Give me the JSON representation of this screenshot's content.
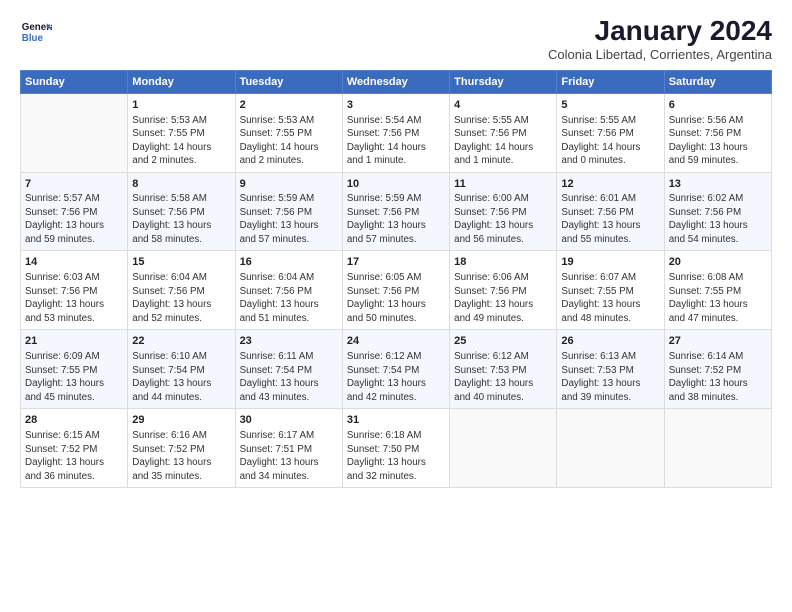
{
  "header": {
    "logo_line1": "General",
    "logo_line2": "Blue",
    "title": "January 2024",
    "subtitle": "Colonia Libertad, Corrientes, Argentina"
  },
  "weekdays": [
    "Sunday",
    "Monday",
    "Tuesday",
    "Wednesday",
    "Thursday",
    "Friday",
    "Saturday"
  ],
  "weeks": [
    [
      {
        "num": "",
        "info": ""
      },
      {
        "num": "1",
        "info": "Sunrise: 5:53 AM\nSunset: 7:55 PM\nDaylight: 14 hours\nand 2 minutes."
      },
      {
        "num": "2",
        "info": "Sunrise: 5:53 AM\nSunset: 7:55 PM\nDaylight: 14 hours\nand 2 minutes."
      },
      {
        "num": "3",
        "info": "Sunrise: 5:54 AM\nSunset: 7:56 PM\nDaylight: 14 hours\nand 1 minute."
      },
      {
        "num": "4",
        "info": "Sunrise: 5:55 AM\nSunset: 7:56 PM\nDaylight: 14 hours\nand 1 minute."
      },
      {
        "num": "5",
        "info": "Sunrise: 5:55 AM\nSunset: 7:56 PM\nDaylight: 14 hours\nand 0 minutes."
      },
      {
        "num": "6",
        "info": "Sunrise: 5:56 AM\nSunset: 7:56 PM\nDaylight: 13 hours\nand 59 minutes."
      }
    ],
    [
      {
        "num": "7",
        "info": "Sunrise: 5:57 AM\nSunset: 7:56 PM\nDaylight: 13 hours\nand 59 minutes."
      },
      {
        "num": "8",
        "info": "Sunrise: 5:58 AM\nSunset: 7:56 PM\nDaylight: 13 hours\nand 58 minutes."
      },
      {
        "num": "9",
        "info": "Sunrise: 5:59 AM\nSunset: 7:56 PM\nDaylight: 13 hours\nand 57 minutes."
      },
      {
        "num": "10",
        "info": "Sunrise: 5:59 AM\nSunset: 7:56 PM\nDaylight: 13 hours\nand 57 minutes."
      },
      {
        "num": "11",
        "info": "Sunrise: 6:00 AM\nSunset: 7:56 PM\nDaylight: 13 hours\nand 56 minutes."
      },
      {
        "num": "12",
        "info": "Sunrise: 6:01 AM\nSunset: 7:56 PM\nDaylight: 13 hours\nand 55 minutes."
      },
      {
        "num": "13",
        "info": "Sunrise: 6:02 AM\nSunset: 7:56 PM\nDaylight: 13 hours\nand 54 minutes."
      }
    ],
    [
      {
        "num": "14",
        "info": "Sunrise: 6:03 AM\nSunset: 7:56 PM\nDaylight: 13 hours\nand 53 minutes."
      },
      {
        "num": "15",
        "info": "Sunrise: 6:04 AM\nSunset: 7:56 PM\nDaylight: 13 hours\nand 52 minutes."
      },
      {
        "num": "16",
        "info": "Sunrise: 6:04 AM\nSunset: 7:56 PM\nDaylight: 13 hours\nand 51 minutes."
      },
      {
        "num": "17",
        "info": "Sunrise: 6:05 AM\nSunset: 7:56 PM\nDaylight: 13 hours\nand 50 minutes."
      },
      {
        "num": "18",
        "info": "Sunrise: 6:06 AM\nSunset: 7:56 PM\nDaylight: 13 hours\nand 49 minutes."
      },
      {
        "num": "19",
        "info": "Sunrise: 6:07 AM\nSunset: 7:55 PM\nDaylight: 13 hours\nand 48 minutes."
      },
      {
        "num": "20",
        "info": "Sunrise: 6:08 AM\nSunset: 7:55 PM\nDaylight: 13 hours\nand 47 minutes."
      }
    ],
    [
      {
        "num": "21",
        "info": "Sunrise: 6:09 AM\nSunset: 7:55 PM\nDaylight: 13 hours\nand 45 minutes."
      },
      {
        "num": "22",
        "info": "Sunrise: 6:10 AM\nSunset: 7:54 PM\nDaylight: 13 hours\nand 44 minutes."
      },
      {
        "num": "23",
        "info": "Sunrise: 6:11 AM\nSunset: 7:54 PM\nDaylight: 13 hours\nand 43 minutes."
      },
      {
        "num": "24",
        "info": "Sunrise: 6:12 AM\nSunset: 7:54 PM\nDaylight: 13 hours\nand 42 minutes."
      },
      {
        "num": "25",
        "info": "Sunrise: 6:12 AM\nSunset: 7:53 PM\nDaylight: 13 hours\nand 40 minutes."
      },
      {
        "num": "26",
        "info": "Sunrise: 6:13 AM\nSunset: 7:53 PM\nDaylight: 13 hours\nand 39 minutes."
      },
      {
        "num": "27",
        "info": "Sunrise: 6:14 AM\nSunset: 7:52 PM\nDaylight: 13 hours\nand 38 minutes."
      }
    ],
    [
      {
        "num": "28",
        "info": "Sunrise: 6:15 AM\nSunset: 7:52 PM\nDaylight: 13 hours\nand 36 minutes."
      },
      {
        "num": "29",
        "info": "Sunrise: 6:16 AM\nSunset: 7:52 PM\nDaylight: 13 hours\nand 35 minutes."
      },
      {
        "num": "30",
        "info": "Sunrise: 6:17 AM\nSunset: 7:51 PM\nDaylight: 13 hours\nand 34 minutes."
      },
      {
        "num": "31",
        "info": "Sunrise: 6:18 AM\nSunset: 7:50 PM\nDaylight: 13 hours\nand 32 minutes."
      },
      {
        "num": "",
        "info": ""
      },
      {
        "num": "",
        "info": ""
      },
      {
        "num": "",
        "info": ""
      }
    ]
  ]
}
